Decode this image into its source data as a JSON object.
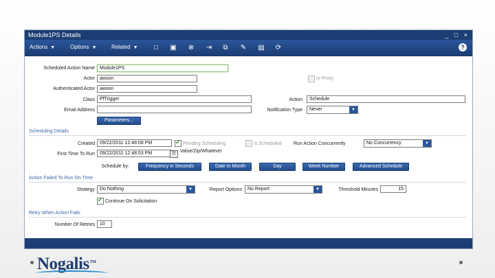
{
  "window": {
    "title": "Module1PS Details",
    "controls": "_ □ ×"
  },
  "toolbar": {
    "actions": "Actions",
    "options": "Options",
    "related": "Related",
    "dropdown_glyph": "▼",
    "icons": [
      "new-document-icon",
      "save-icon",
      "cancel-icon",
      "export-icon",
      "copy-icon",
      "edit-icon",
      "attach-icon",
      "refresh-icon"
    ],
    "help": "?"
  },
  "form": {
    "scheduled_action_name_label": "Scheduled Action Name",
    "scheduled_action_name": "Module1PS",
    "actor_label": "Actor",
    "actor": "awson",
    "is_proxy_label": "Is Proxy",
    "authenticated_actor_label": "Authenticated Actor",
    "authenticated_actor": "awson",
    "class_label": "Class",
    "class": "PfTrigger",
    "action_label": "Action",
    "action": "Schedule",
    "email_label": "Email Address",
    "email": "",
    "notification_type_label": "Notification Type",
    "notification_type": "Never",
    "parameters_button": "Parameters..."
  },
  "scheduling": {
    "section_title": "Scheduling Details",
    "created_label": "Created",
    "created": "09/22/2011 12:48:08 PM",
    "pending_label": "Pending Scheduling",
    "is_scheduled_label": "Is Scheduled",
    "concurrency_label": "Run Action Concurrently",
    "concurrency": "No Concurrency",
    "first_time_label": "First Time To Run",
    "first_time": "09/22/2011 12:48:53 PM",
    "hint": "Value/Zip/Whatever",
    "schedule_by_label": "Schedule by:",
    "buttons": [
      "Frequency in Seconds",
      "Date In Month",
      "Day",
      "Week Number",
      "Advanced Schedule"
    ]
  },
  "failure": {
    "section_title": "Action Failed To Run On Time",
    "strategy_label": "Strategy",
    "strategy": "Do Nothing",
    "report_options_label": "Report Options",
    "report_options": "No Report",
    "threshold_label": "Threshold Minutes",
    "threshold": "15",
    "continue_label": "Continue On Solicitation"
  },
  "retry": {
    "section_title": "Retry When Action Fails",
    "number_label": "Number Of Retries",
    "number": "10"
  },
  "branding": {
    "logo": "Nogalis",
    "tm": "TM"
  }
}
